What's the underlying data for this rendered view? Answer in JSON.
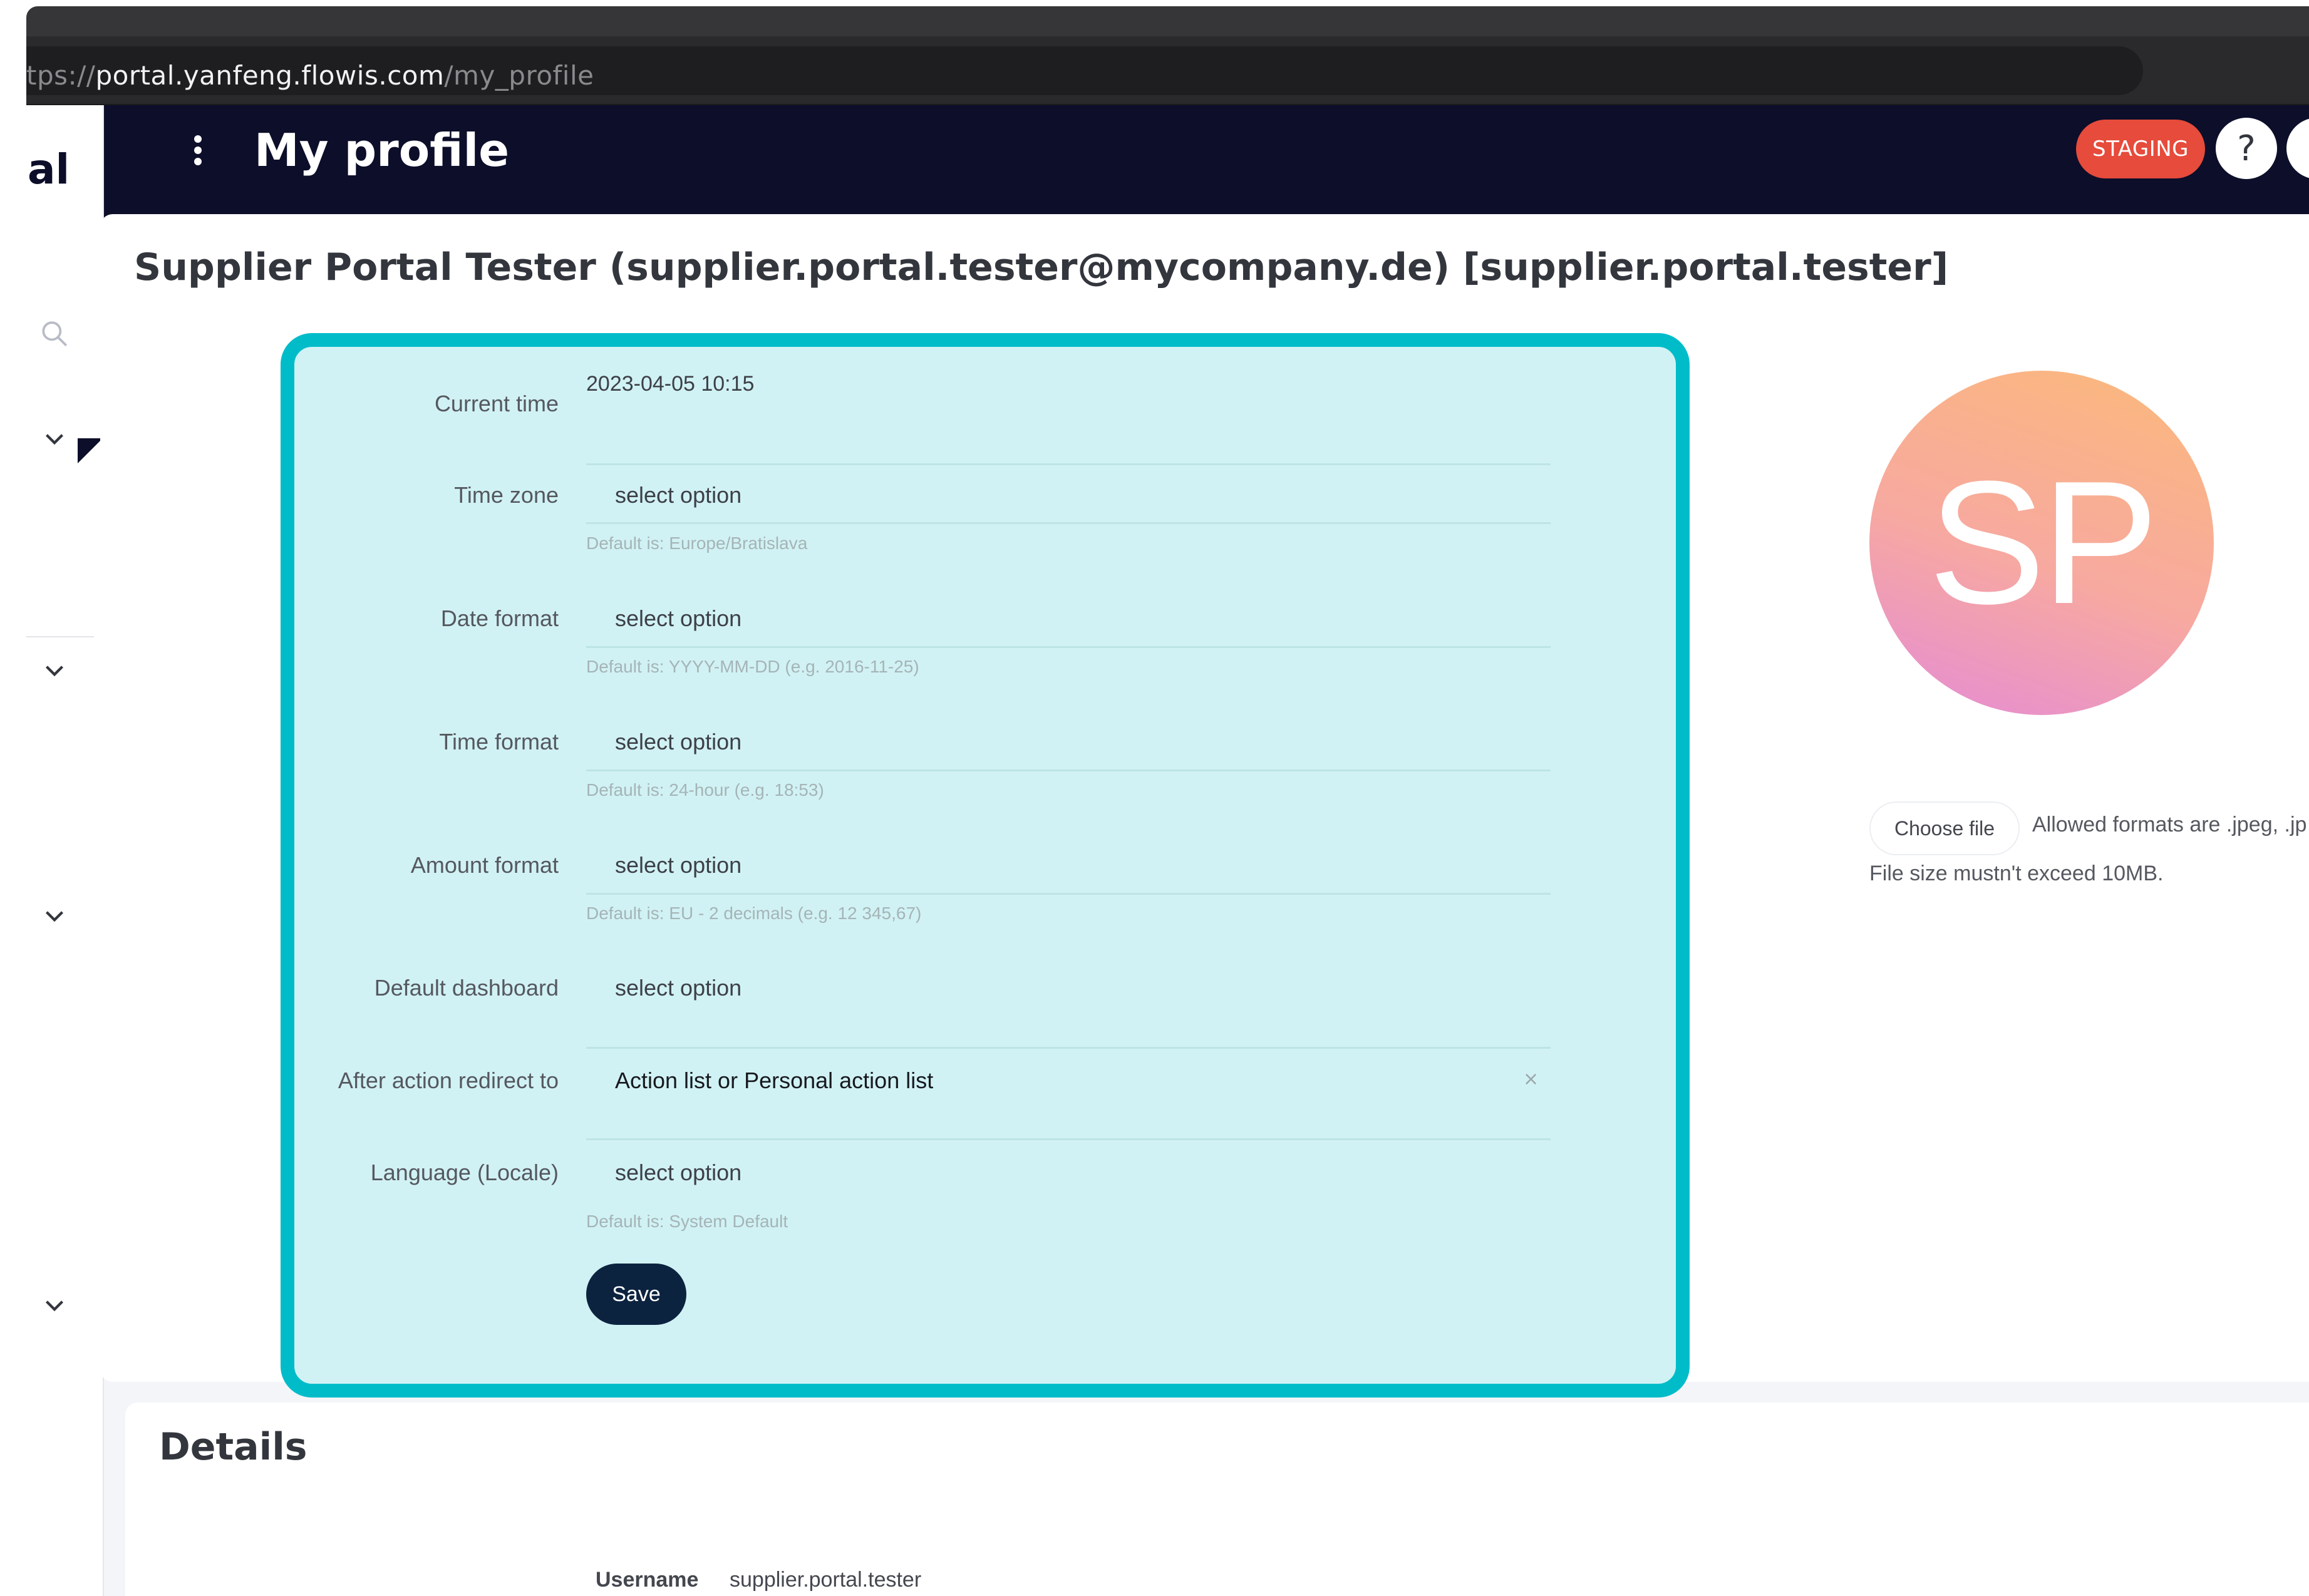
{
  "browser": {
    "url_prefix": "tps://",
    "url_host": "portal.yanfeng.flowis.com",
    "url_path": "/my_profile"
  },
  "sidebar": {
    "title": "al",
    "icons": [
      "search-icon",
      "chevron-down-icon",
      "chevron-down-icon",
      "chevron-down-icon",
      "chevron-down-icon"
    ]
  },
  "header": {
    "menu_icon": "kebab-menu-icon",
    "title": "My profile",
    "badge": "STAGING",
    "help_label": "?",
    "bell_icon": "bell-icon",
    "colors": {
      "bar": "#0c0e2a",
      "badge": "#e64b3b"
    }
  },
  "profile": {
    "heading": "Supplier Portal Tester (supplier.portal.tester@mycompany.de) [supplier.portal.tester]",
    "form": {
      "current_time": {
        "label": "Current time",
        "value": "2023-04-05 10:15"
      },
      "time_zone": {
        "label": "Time zone",
        "value": "select option",
        "hint": "Default is: Europe/Bratislava"
      },
      "date_format": {
        "label": "Date format",
        "value": "select option",
        "hint": "Default is: YYYY-MM-DD (e.g. 2016-11-25)"
      },
      "time_format": {
        "label": "Time format",
        "value": "select option",
        "hint": "Default is: 24-hour (e.g. 18:53)"
      },
      "amount_format": {
        "label": "Amount format",
        "value": "select option",
        "hint": "Default is: EU - 2 decimals (e.g. 12 345,67)"
      },
      "default_dashboard": {
        "label": "Default dashboard",
        "value": "select option"
      },
      "after_action": {
        "label": "After action redirect to",
        "value": "Action list or Personal action list",
        "clear": "×"
      },
      "language": {
        "label": "Language (Locale)",
        "value": "select option",
        "hint": "Default is: System Default"
      },
      "save_label": "Save"
    },
    "avatar": {
      "initials": "SP",
      "choose_file": "Choose file",
      "allowed_formats": "Allowed formats are .jpeg, .jp",
      "size_limit": "File size mustn't exceed 10MB."
    },
    "highlight_color": "#00bcc9"
  },
  "details": {
    "title": "Details",
    "username_label": "Username",
    "username_value": "supplier.portal.tester"
  }
}
